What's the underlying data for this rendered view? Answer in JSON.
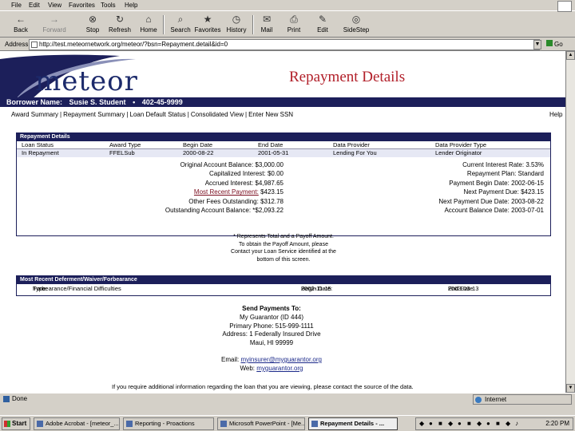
{
  "menu": [
    "File",
    "Edit",
    "View",
    "Favorites",
    "Tools",
    "Help"
  ],
  "toolbar": [
    {
      "label": "Back",
      "icon": "back-arrow-icon",
      "glyph": "←",
      "enabled": true
    },
    {
      "label": "Forward",
      "icon": "forward-arrow-icon",
      "glyph": "→",
      "enabled": false
    },
    {
      "label": "Stop",
      "icon": "stop-icon",
      "glyph": "⊗",
      "enabled": true
    },
    {
      "label": "Refresh",
      "icon": "refresh-icon",
      "glyph": "↻",
      "enabled": true
    },
    {
      "label": "Home",
      "icon": "home-icon",
      "glyph": "⌂",
      "enabled": true
    },
    {
      "label": "Search",
      "icon": "search-icon",
      "glyph": "⌕",
      "enabled": true
    },
    {
      "label": "Favorites",
      "icon": "favorites-icon",
      "glyph": "★",
      "enabled": true
    },
    {
      "label": "History",
      "icon": "history-icon",
      "glyph": "◷",
      "enabled": true
    },
    {
      "label": "Mail",
      "icon": "mail-icon",
      "glyph": "✉",
      "enabled": true
    },
    {
      "label": "Print",
      "icon": "print-icon",
      "glyph": "⎙",
      "enabled": true
    },
    {
      "label": "Edit",
      "icon": "edit-icon",
      "glyph": "✎",
      "enabled": true
    },
    {
      "label": "SideStep",
      "icon": "sidestep-icon",
      "glyph": "◎",
      "enabled": true
    }
  ],
  "address": {
    "label": "Address",
    "url": "http://test.meteornetwork.org/meteor/?bsn=Repayment.detail&id=0",
    "go_label": "Go"
  },
  "page": {
    "logo": "meteor",
    "title": "Repayment Details",
    "borrower_label": "Borrower Name:",
    "borrower_name": "Susie S. Student",
    "borrower_sep": "•",
    "borrower_ssn": "402-45-9999",
    "tabs": [
      "Award Summary",
      "Repayment Summary",
      "Loan Default Status",
      "Consolidated View",
      "Enter New SSN"
    ],
    "help": "Help"
  },
  "repayment": {
    "section_title": "Repayment Details",
    "headers": [
      "Loan Status",
      "Award Type",
      "Begin Date",
      "End Date",
      "Data Provider",
      "Data Provider Type"
    ],
    "row": [
      "In Repayment",
      "FFELSub",
      "2000-08-22",
      "2001-05-31",
      "Lending For You",
      "Lender Originator"
    ],
    "left": [
      {
        "label": "Original Account Balance:",
        "value": "$3,000.00"
      },
      {
        "label": "Capitalized Interest:",
        "value": "$0.00"
      },
      {
        "label": "Accrued Interest:",
        "value": "$4,987.65"
      },
      {
        "label": "Most Recent Payment:",
        "value": "$423.15",
        "link": true
      },
      {
        "label": "Other Fees Outstanding:",
        "value": "$312.78"
      },
      {
        "label": "Outstanding Account Balance:",
        "value": "*$2,093.22"
      }
    ],
    "right": [
      {
        "label": "Current Interest Rate:",
        "value": "3.53%"
      },
      {
        "label": "Repayment Plan:",
        "value": "Standard"
      },
      {
        "label": "Payment Begin Date:",
        "value": "2002-06-15"
      },
      {
        "label": "Next Payment Due:",
        "value": "$423.15"
      },
      {
        "label": "Next Payment Due Date:",
        "value": "2003-08-22"
      },
      {
        "label": "Account Balance Date:",
        "value": "2003-07-01"
      }
    ],
    "note": [
      "* Represents Total and a Payoff Amount.",
      "To obtain the Payoff Amount, please",
      "Contact your Loan Service identified at the",
      "bottom of this screen."
    ]
  },
  "deferment": {
    "section_title": "Most Recent Deferment/Waiver/Forbearance",
    "type_label": "Type:",
    "type_value": "Forbearance/Financial Difficulties",
    "begin_label": "Begin Date:",
    "begin_value": "2002-11-15",
    "end_label": "End Date:",
    "end_value": "2003-03-13"
  },
  "send": {
    "heading": "Send Payments To:",
    "lines": [
      "My Guarantor (ID 444)",
      "Primary Phone: 515-999-1111",
      "Address: 1 Federally Insured Drive",
      "Maui, HI 99999"
    ],
    "email_label": "Email:",
    "email": "myinsurer@myguarantor.org",
    "web_label": "Web:",
    "web": "myguarantor.org"
  },
  "footer_note": "If you require additional information regarding the loan that you are viewing, please contact the source of the data.",
  "status": {
    "text": "Done",
    "zone": "Internet"
  },
  "taskbar": {
    "start": "Start",
    "tasks": [
      {
        "label": "Adobe Acrobat - [meteor_..."
      },
      {
        "label": "Reporting - Proactions"
      },
      {
        "label": "Microsoft PowerPoint - [Me..."
      },
      {
        "label": "Repayment Details - ...",
        "active": true
      }
    ],
    "clock": "2:20 PM"
  }
}
